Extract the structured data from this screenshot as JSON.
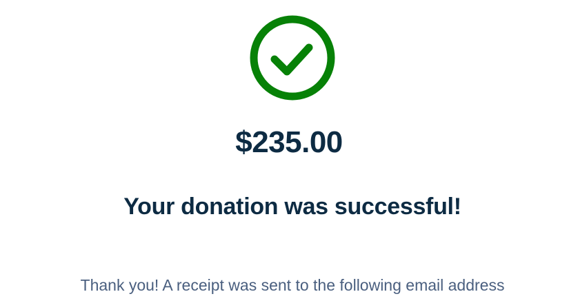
{
  "confirmation": {
    "icon": "check-circle-icon",
    "icon_color": "#078107",
    "amount": "$235.00",
    "headline": "Your donation was successful!",
    "message": "Thank you! A receipt was sent to the following email address"
  },
  "colors": {
    "heading_text": "#0d2b43",
    "body_text": "#4a5f7f",
    "background": "#ffffff"
  }
}
